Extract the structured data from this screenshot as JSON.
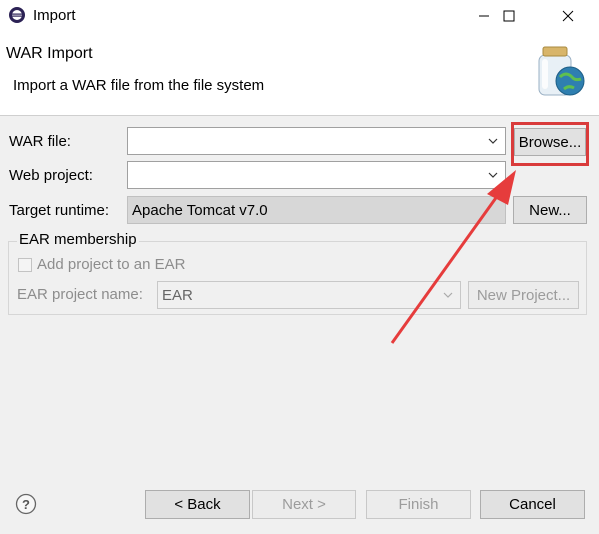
{
  "window": {
    "title": "Import",
    "icon": "eclipse-app-icon",
    "controls": [
      "minimize-icon",
      "maximize-icon",
      "close-icon"
    ]
  },
  "header": {
    "title": "WAR Import",
    "description": "Import a WAR file from the file system",
    "banner_icon": "war-jar-globe-icon"
  },
  "form": {
    "war_file": {
      "label": "WAR file:",
      "value": "",
      "browse_label": "Browse..."
    },
    "web_project": {
      "label": "Web project:",
      "value": ""
    },
    "target_runtime": {
      "label": "Target runtime:",
      "value": "Apache Tomcat v7.0",
      "new_label": "New..."
    },
    "ear": {
      "group_title": "EAR membership",
      "checkbox_label": "Add project to an EAR",
      "checked": false,
      "project_name_label": "EAR project name:",
      "project_name_value": "EAR",
      "new_project_label": "New Project..."
    }
  },
  "footer": {
    "help_icon": "help-icon",
    "back_label": "< Back",
    "next_label": "Next >",
    "finish_label": "Finish",
    "cancel_label": "Cancel"
  },
  "annotation": {
    "highlight_color": "#d93b3b"
  }
}
